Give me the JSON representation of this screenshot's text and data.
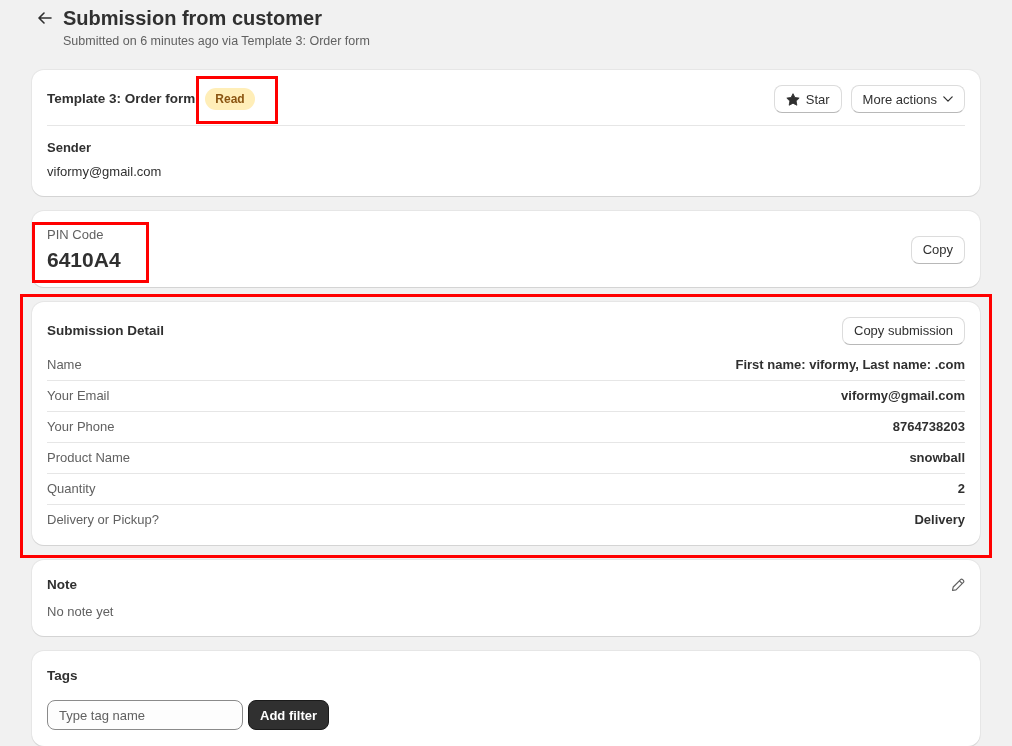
{
  "header": {
    "title": "Submission from customer",
    "subtitle": "Submitted on 6 minutes ago via Template 3: Order form"
  },
  "form_card": {
    "title": "Template 3: Order form",
    "status": {
      "label": "Read",
      "highlighted": true
    },
    "actions": [
      {
        "label": "Star",
        "kind": "star"
      },
      {
        "label": "More actions",
        "kind": "menu"
      }
    ],
    "sender_label": "Sender",
    "sender_value": "viformy@gmail.com"
  },
  "pin_card": {
    "label": "PIN Code",
    "value": "6410A4",
    "highlighted": true,
    "action": "Copy"
  },
  "detail_card": {
    "title": "Submission Detail",
    "action": "Copy submission",
    "highlighted": true,
    "fields": [
      {
        "label": "Name",
        "value": "First name: viformy, Last name: .com"
      },
      {
        "label": "Your Email",
        "value": "viformy@gmail.com"
      },
      {
        "label": "Your Phone",
        "value": "8764738203"
      },
      {
        "label": "Product Name",
        "value": "snowball"
      },
      {
        "label": "Quantity",
        "value": "2"
      },
      {
        "label": "Delivery or Pickup?",
        "value": "Delivery"
      }
    ]
  },
  "note_card": {
    "title": "Note",
    "text": "No note yet"
  },
  "tags_card": {
    "title": "Tags",
    "input": {
      "placeholder": "Type tag name"
    },
    "button": "Add filter"
  }
}
